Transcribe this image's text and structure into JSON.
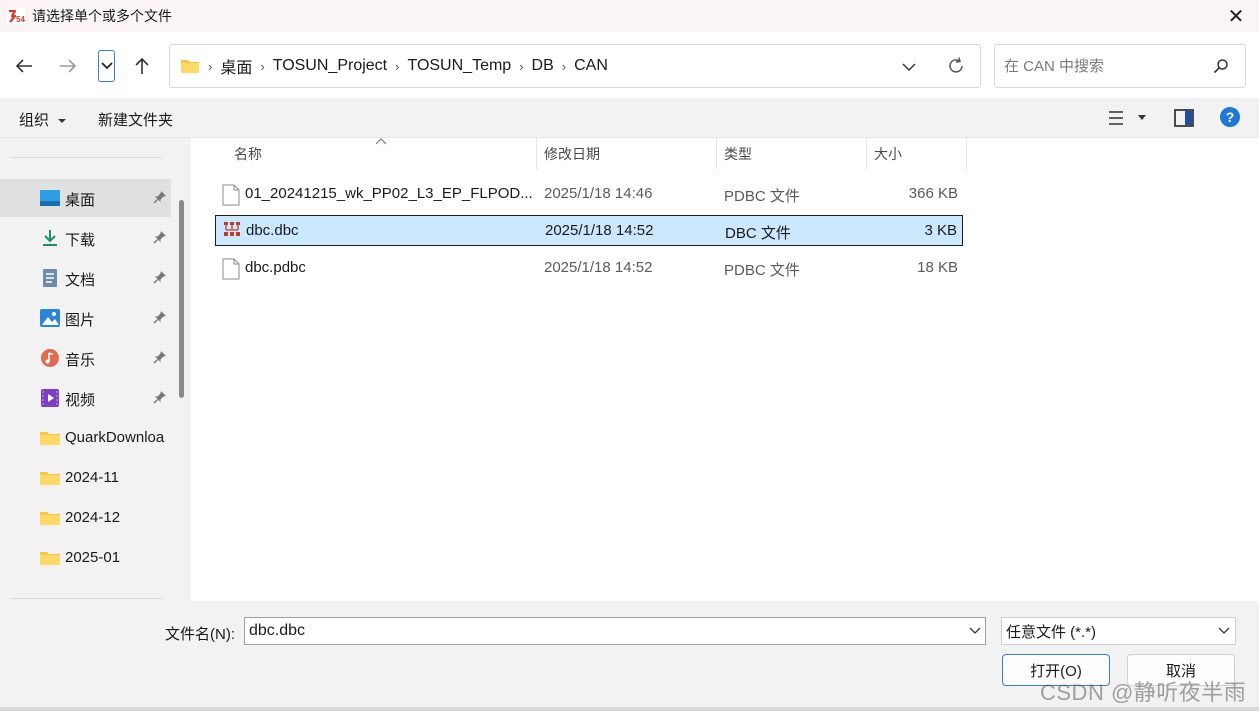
{
  "window": {
    "title": "请选择单个或多个文件",
    "app_icon": "tosun-app-icon",
    "close_glyph": "✕"
  },
  "navigation": {
    "back_icon": "arrow-left-icon",
    "forward_icon": "arrow-right-icon",
    "recent_icon": "chevron-down-icon",
    "up_icon": "arrow-up-icon",
    "breadcrumbs": [
      "桌面",
      "TOSUN_Project",
      "TOSUN_Temp",
      "DB",
      "CAN"
    ],
    "search_placeholder": "在 CAN 中搜索"
  },
  "toolbar": {
    "organize_label": "组织",
    "new_folder_label": "新建文件夹"
  },
  "sidebar": {
    "items": [
      {
        "label": "桌面",
        "icon": "desktop-icon",
        "pinned": true,
        "active": true
      },
      {
        "label": "下载",
        "icon": "download-icon",
        "pinned": true
      },
      {
        "label": "文档",
        "icon": "document-icon",
        "pinned": true
      },
      {
        "label": "图片",
        "icon": "pictures-icon",
        "pinned": true
      },
      {
        "label": "音乐",
        "icon": "music-icon",
        "pinned": true
      },
      {
        "label": "视频",
        "icon": "video-icon",
        "pinned": true
      },
      {
        "label": "QuarkDownloa",
        "icon": "folder-icon",
        "pinned": false
      },
      {
        "label": "2024-11",
        "icon": "folder-icon",
        "pinned": false
      },
      {
        "label": "2024-12",
        "icon": "folder-icon",
        "pinned": false
      },
      {
        "label": "2025-01",
        "icon": "folder-icon",
        "pinned": false
      }
    ]
  },
  "file_list": {
    "columns": [
      "名称",
      "修改日期",
      "类型",
      "大小"
    ],
    "rows": [
      {
        "name": "01_20241215_wk_PP02_L3_EP_FLPOD...",
        "date": "2025/1/18 14:46",
        "type": "PDBC 文件",
        "size": "366 KB",
        "icon": "file-icon",
        "selected": false
      },
      {
        "name": "dbc.dbc",
        "date": "2025/1/18 14:52",
        "type": "DBC 文件",
        "size": "3 KB",
        "icon": "dbc-file-icon",
        "selected": true
      },
      {
        "name": "dbc.pdbc",
        "date": "2025/1/18 14:52",
        "type": "PDBC 文件",
        "size": "18 KB",
        "icon": "file-icon",
        "selected": false
      }
    ]
  },
  "bottom": {
    "filename_label": "文件名(N):",
    "filename_value": "dbc.dbc",
    "filetype_value": "任意文件 (*.*)",
    "open_label": "打开(O)",
    "cancel_label": "取消"
  },
  "watermark": "CSDN @静听夜半雨",
  "colors": {
    "selection_bg": "#cce8ff",
    "accent": "#3b7bd6",
    "pane_bg": "#f2f2f2",
    "folder_yellow": "#f4c54a"
  }
}
